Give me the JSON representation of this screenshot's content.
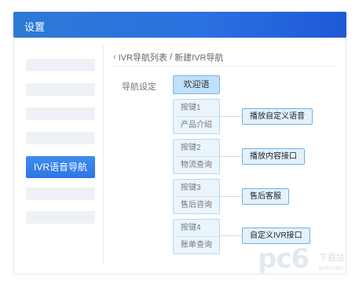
{
  "window": {
    "title": "设置"
  },
  "sidebar": {
    "active_label": "IVR语音导航"
  },
  "breadcrumb": {
    "parent": "IVR导航列表",
    "separator": "/",
    "current": "新建IVR导航"
  },
  "form": {
    "nav_label": "导航设定",
    "welcome": "欢迎语",
    "keys": [
      {
        "key": "按键1",
        "desc": "产品介绍",
        "action": "播放自定义语音"
      },
      {
        "key": "按键2",
        "desc": "物流查询",
        "action": "播放内容接口"
      },
      {
        "key": "按键3",
        "desc": "售后咨询",
        "action": "售后客服"
      },
      {
        "key": "按键4",
        "desc": "账单查询",
        "action": "自定义IVR接口"
      }
    ]
  },
  "watermark": {
    "logo_text": "pc6",
    "small_text": "下载站",
    "url": "pc6.com"
  },
  "colors": {
    "title_bar": "#2a6fe0",
    "active_item": "#3182e6",
    "welcome_fill": "#bfe0f8",
    "action_border": "#6eb0e6"
  }
}
